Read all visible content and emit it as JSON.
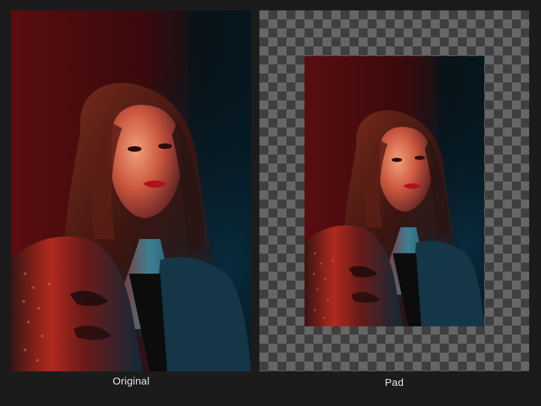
{
  "captions": {
    "original": "Original",
    "pad": "Pad"
  },
  "palette": {
    "background": "#1b1b1b",
    "checker_light": "#666666",
    "checker_dark": "#3f3f3f",
    "red_light": "#b2201c",
    "teal_light": "#1f6f8a"
  },
  "images": {
    "original": {
      "subject": "portrait-woman-red-blue-light"
    },
    "pad": {
      "subject": "portrait-woman-red-blue-light",
      "transparent_padding": true
    }
  }
}
